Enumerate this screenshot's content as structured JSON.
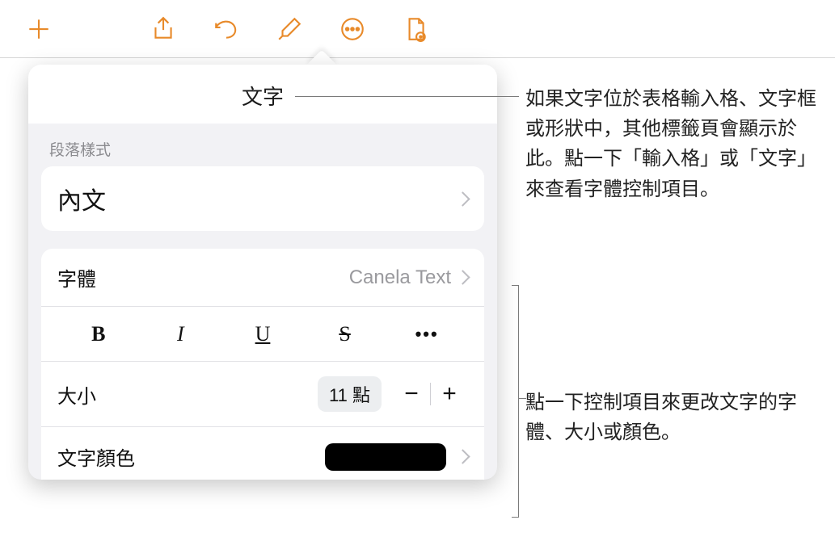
{
  "toolbar": {
    "add": "add-icon",
    "share": "share-icon",
    "undo": "undo-icon",
    "format": "format-brush-icon",
    "more": "more-icon",
    "document": "document-icon"
  },
  "popover": {
    "title": "文字",
    "section_paragraph_styles": "段落樣式",
    "paragraph_style_value": "內文",
    "font_label": "字體",
    "font_value": "Canela Text",
    "bius": {
      "b": "B",
      "i": "I",
      "u": "U",
      "s": "S",
      "more": "•••"
    },
    "size_label": "大小",
    "size_value": "11 點",
    "stepper_minus": "−",
    "stepper_plus": "+",
    "text_color_label": "文字顏色",
    "text_color_value": "#000000"
  },
  "callouts": {
    "c1": "如果文字位於表格輸入格、文字框或形狀中，其他標籤頁會顯示於此。點一下「輸入格」或「文字」來查看字體控制項目。",
    "c2": "點一下控制項目來更改文字的字體、大小或顏色。"
  }
}
